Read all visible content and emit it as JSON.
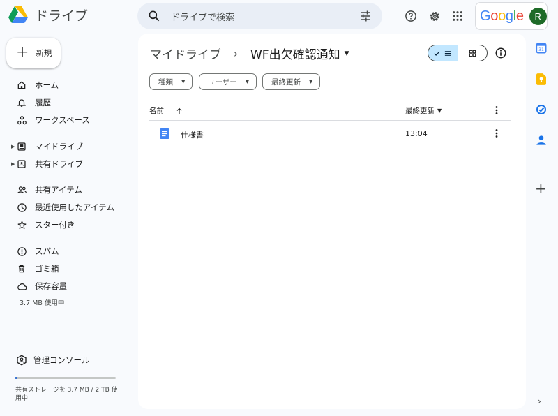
{
  "app": {
    "name": "ドライブ"
  },
  "search": {
    "placeholder": "ドライブで検索"
  },
  "account": {
    "brand": "Google",
    "initial": "R"
  },
  "new_button": {
    "label": "新規"
  },
  "sidebar": {
    "items": [
      {
        "label": "ホーム",
        "icon": "home-icon"
      },
      {
        "label": "履歴",
        "icon": "bell-icon"
      },
      {
        "label": "ワークスペース",
        "icon": "workspace-icon"
      },
      {
        "label": "マイドライブ",
        "icon": "my-drive-icon"
      },
      {
        "label": "共有ドライブ",
        "icon": "shared-drives-icon"
      },
      {
        "label": "共有アイテム",
        "icon": "shared-with-me-icon"
      },
      {
        "label": "最近使用したアイテム",
        "icon": "clock-icon"
      },
      {
        "label": "スター付き",
        "icon": "star-icon"
      },
      {
        "label": "スパム",
        "icon": "spam-icon"
      },
      {
        "label": "ゴミ箱",
        "icon": "trash-icon"
      },
      {
        "label": "保存容量",
        "icon": "cloud-icon"
      }
    ],
    "storage_used": "3.7 MB 使用中",
    "admin_label": "管理コンソール",
    "storage_detail": "共有ストレージを 3.7 MB / 2 TB 使用中",
    "storage_fraction": 1.8e-06
  },
  "breadcrumb": {
    "root": "マイドライブ",
    "separator": "›",
    "current": "WF出欠確認通知"
  },
  "filters": [
    {
      "label": "種類"
    },
    {
      "label": "ユーザー"
    },
    {
      "label": "最終更新"
    }
  ],
  "table": {
    "col_name": "名前",
    "col_modified": "最終更新",
    "rows": [
      {
        "name": "仕様書",
        "modified": "13:04",
        "type": "docs"
      }
    ]
  },
  "colors": {
    "accent": "#0b57d0",
    "toggle_on": "#c2e7ff",
    "docs_blue": "#4285f4",
    "avatar": "#1e6b28"
  }
}
